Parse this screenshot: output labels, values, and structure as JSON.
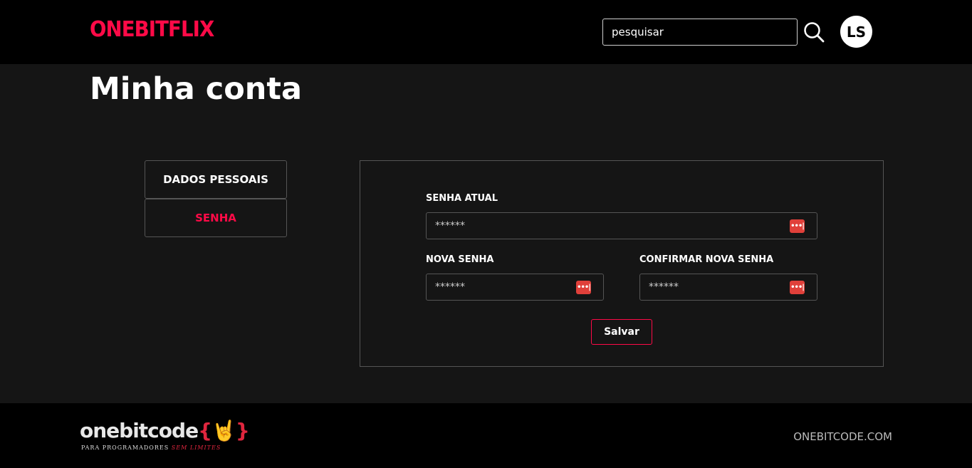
{
  "header": {
    "logo": "ONEBITFLIX",
    "search_placeholder": "pesquisar",
    "avatar_initials": "LS"
  },
  "page": {
    "title": "Minha conta"
  },
  "tabs": [
    {
      "label": "DADOS PESSOAIS",
      "active": false
    },
    {
      "label": "SENHA",
      "active": true
    }
  ],
  "form": {
    "current_password_label": "SENHA ATUAL",
    "current_password_value": "******",
    "new_password_label": "NOVA SENHA",
    "new_password_value": "******",
    "confirm_password_label": "CONFIRMAR NOVA SENHA",
    "confirm_password_value": "******",
    "save_label": "Salvar"
  },
  "footer": {
    "brand_main": "onebitcode",
    "brand_braces": "{🤘}",
    "tagline_main": "PARA PROGRAMADORES",
    "tagline_accent": "SEM LIMITES",
    "link": "ONEBITCODE.COM"
  },
  "colors": {
    "accent": "#ff0a47",
    "background": "#151515",
    "header": "#000000",
    "password_icon": "#e0403a"
  }
}
